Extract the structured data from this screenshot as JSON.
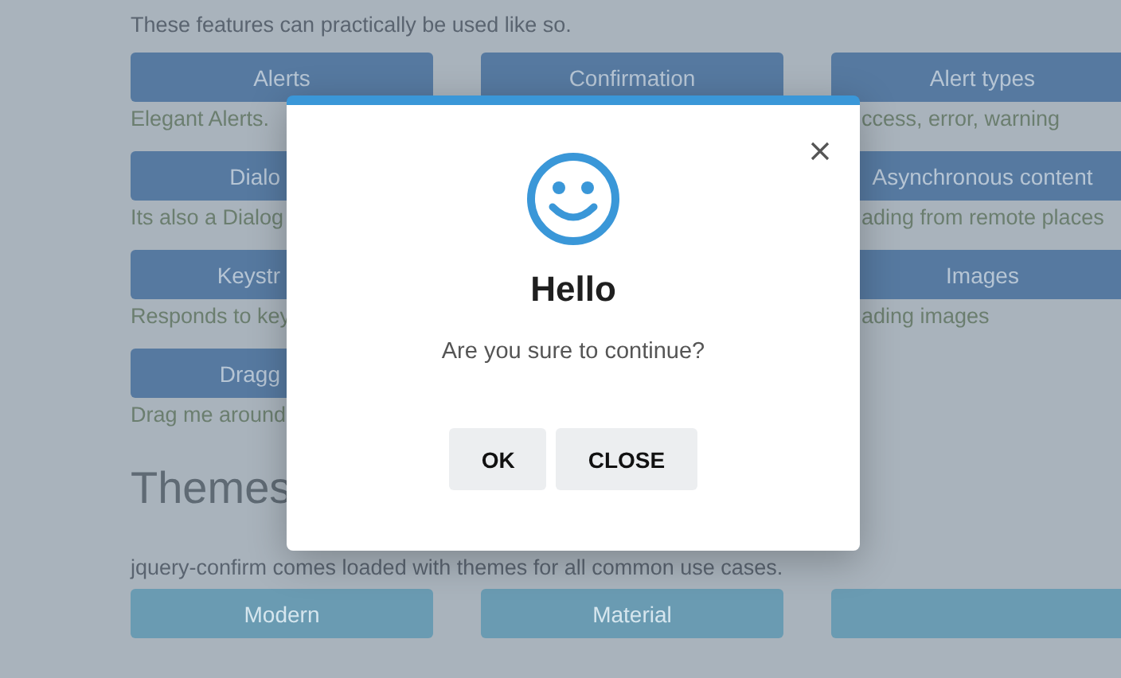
{
  "intro": "These features can practically be used like so.",
  "feature_rows": [
    {
      "cells": [
        {
          "label": "Alerts",
          "description": "Elegant Alerts."
        },
        {
          "label": "Confirmation"
        },
        {
          "label": "Alert types",
          "description": "ccess, error, warning"
        }
      ]
    },
    {
      "cells": [
        {
          "label": "Dialo",
          "description": "Its also a Dialog"
        },
        null,
        {
          "label": "Asynchronous content",
          "description": "ading from remote places"
        }
      ]
    },
    {
      "cells": [
        {
          "label": "Keystr",
          "description": "Responds to key"
        },
        null,
        {
          "label": "Images",
          "description": "ading images"
        }
      ]
    },
    {
      "cells": [
        {
          "label": "Dragg",
          "description": "Drag me around"
        },
        null,
        null
      ]
    }
  ],
  "themes": {
    "heading": "Themes",
    "description": "jquery-confirm comes loaded with themes for all common use cases.",
    "buttons": [
      "Modern",
      "Material"
    ]
  },
  "dialog": {
    "title": "Hello",
    "content": "Are you sure to continue?",
    "buttons": [
      {
        "label": "OK"
      },
      {
        "label": "CLOSE"
      }
    ]
  }
}
